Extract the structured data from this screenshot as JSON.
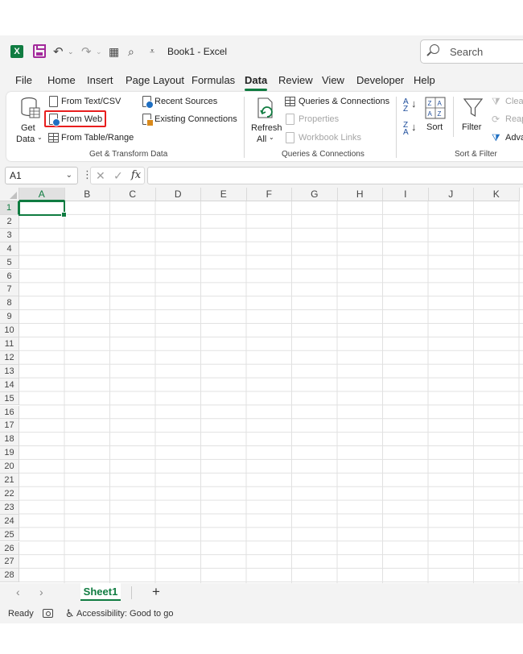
{
  "titlebar": {
    "doc_title": "Book1  -  Excel",
    "search_placeholder": "Search",
    "qat": {
      "app_icon": "excel-logo-icon",
      "save_icon": "save-icon",
      "undo_icon": "undo-icon",
      "redo_icon": "redo-icon",
      "customize_icon": "customize-qat-icon"
    }
  },
  "tabs": [
    {
      "label": "File"
    },
    {
      "label": "Home"
    },
    {
      "label": "Insert"
    },
    {
      "label": "Page Layout"
    },
    {
      "label": "Formulas"
    },
    {
      "label": "Data",
      "active": true
    },
    {
      "label": "Review"
    },
    {
      "label": "View"
    },
    {
      "label": "Developer"
    },
    {
      "label": "Help"
    }
  ],
  "ribbon": {
    "get_transform": {
      "get_data_label_1": "Get",
      "get_data_label_2": "Data",
      "from_text_csv": "From Text/CSV",
      "from_web": "From Web",
      "from_table_range": "From Table/Range",
      "recent_sources": "Recent Sources",
      "existing_connections": "Existing Connections",
      "group_label": "Get & Transform Data"
    },
    "queries": {
      "refresh_label_1": "Refresh",
      "refresh_label_2": "All",
      "queries_connections": "Queries & Connections",
      "properties": "Properties",
      "workbook_links": "Workbook Links",
      "group_label": "Queries & Connections"
    },
    "sort_filter": {
      "sort": "Sort",
      "filter": "Filter",
      "clear": "Clea",
      "reapply": "Reap",
      "advanced": "Adva",
      "group_label": "Sort & Filter"
    }
  },
  "formula_bar": {
    "name_box": "A1",
    "formula_value": ""
  },
  "grid": {
    "columns": [
      "A",
      "B",
      "C",
      "D",
      "E",
      "F",
      "G",
      "H",
      "I",
      "J",
      "K"
    ],
    "rows": [
      "1",
      "2",
      "3",
      "4",
      "5",
      "6",
      "7",
      "8",
      "9",
      "10",
      "11",
      "12",
      "13",
      "14",
      "15",
      "16",
      "17",
      "18",
      "19",
      "20",
      "21",
      "22",
      "23",
      "24",
      "25",
      "26",
      "27",
      "28"
    ],
    "active_cell": "A1"
  },
  "sheets": [
    {
      "label": "Sheet1",
      "active": true
    }
  ],
  "status": {
    "ready": "Ready",
    "accessibility": "Accessibility: Good to go"
  },
  "colors": {
    "accent": "#107c41",
    "highlight": "#e81e1e",
    "chrome": "#f3f3f3"
  }
}
